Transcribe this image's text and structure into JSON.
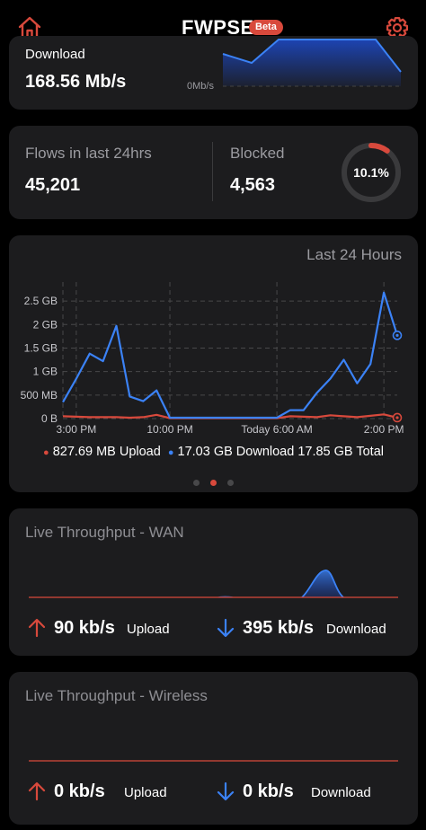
{
  "header": {
    "title": "FWPSE",
    "badge": "Beta"
  },
  "download_card": {
    "label": "Download",
    "value": "168.56 Mb/s",
    "axis_label": "0Mb/s"
  },
  "flows_card": {
    "flows_label": "Flows in last 24hrs",
    "flows_value": "45,201",
    "blocked_label": "Blocked",
    "blocked_value": "4,563",
    "blocked_percent_label": "10.1%",
    "blocked_fraction": 0.101
  },
  "history_card": {
    "title": "Last 24 Hours",
    "legend": {
      "upload": "827.69 MB Upload",
      "download": "17.03 GB Download",
      "total": "17.85 GB Total"
    },
    "page_dots": {
      "count": 3,
      "active": 1
    }
  },
  "chart_data": {
    "type": "line",
    "title": "Last 24 Hours",
    "y_unit": "GB",
    "ylim": [
      0,
      2.75
    ],
    "y_ticks": [
      {
        "value": 0,
        "label": "0 B"
      },
      {
        "value": 0.5,
        "label": "500 MB"
      },
      {
        "value": 1,
        "label": "1 GB"
      },
      {
        "value": 1.5,
        "label": "1.5 GB"
      },
      {
        "value": 2,
        "label": "2 GB"
      },
      {
        "value": 2.5,
        "label": "2.5 GB"
      }
    ],
    "x_ticks": [
      {
        "index": 1,
        "label": "3:00 PM"
      },
      {
        "index": 8,
        "label": "10:00 PM"
      },
      {
        "index": 16,
        "label": "Today 6:00 AM"
      },
      {
        "index": 24,
        "label": "2:00 PM"
      }
    ],
    "x_count": 26,
    "grid": true,
    "series": [
      {
        "name": "Download",
        "color": "#3b82f6",
        "values": [
          0.35,
          0.85,
          1.38,
          1.22,
          1.97,
          0.47,
          0.37,
          0.6,
          0.02,
          0.02,
          0.02,
          0.02,
          0.02,
          0.02,
          0.02,
          0.02,
          0.02,
          0.18,
          0.18,
          0.55,
          0.85,
          1.25,
          0.75,
          1.16,
          2.68,
          1.77
        ]
      },
      {
        "name": "Upload",
        "color": "#d8493c",
        "values": [
          0.05,
          0.04,
          0.03,
          0.03,
          0.03,
          0.02,
          0.03,
          0.08,
          0.01,
          0.01,
          0.01,
          0.01,
          0.01,
          0.01,
          0.01,
          0.01,
          0.01,
          0.05,
          0.04,
          0.03,
          0.07,
          0.05,
          0.03,
          0.06,
          0.09,
          0.02
        ]
      }
    ]
  },
  "wan_card": {
    "title": "Live Throughput - WAN",
    "upload_value": "90 kb/s",
    "upload_label": "Upload",
    "download_value": "395 kb/s",
    "download_label": "Download"
  },
  "wireless_card": {
    "title": "Live Throughput - Wireless",
    "upload_value": "0 kb/s",
    "upload_label": "Upload",
    "download_value": "0 kb/s",
    "download_label": "Download"
  },
  "colors": {
    "accent_red": "#d8493c",
    "accent_blue": "#3b82f6",
    "card_bg": "#1c1c1e",
    "muted_text": "#9b9ba0"
  }
}
